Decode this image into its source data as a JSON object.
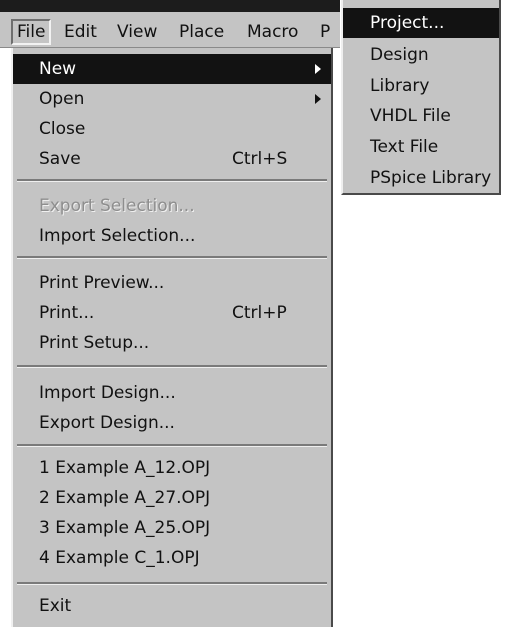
{
  "menubar": {
    "items": [
      "File",
      "Edit",
      "View",
      "Place",
      "Macro",
      "P"
    ]
  },
  "file_menu": {
    "items": [
      {
        "label": "New",
        "submenu_arrow": true,
        "highlighted": true
      },
      {
        "label": "Open",
        "submenu_arrow": true
      },
      {
        "label": "Close"
      },
      {
        "label": "Save",
        "shortcut": "Ctrl+S"
      },
      {
        "label": "Export Selection...",
        "disabled": true
      },
      {
        "label": "Import Selection..."
      },
      {
        "label": "Print Preview..."
      },
      {
        "label": "Print...",
        "shortcut": "Ctrl+P"
      },
      {
        "label": "Print Setup..."
      },
      {
        "label": "Import Design..."
      },
      {
        "label": "Export Design..."
      },
      {
        "label": "1 Example A_12.OPJ"
      },
      {
        "label": "2 Example A_27.OPJ"
      },
      {
        "label": "3 Example A_25.OPJ"
      },
      {
        "label": "4 Example C_1.OPJ"
      },
      {
        "label": "Exit"
      }
    ]
  },
  "new_submenu": {
    "items": [
      {
        "label": "Project...",
        "highlighted": true
      },
      {
        "label": "Design"
      },
      {
        "label": "Library"
      },
      {
        "label": "VHDL File"
      },
      {
        "label": "Text File"
      },
      {
        "label": "PSpice Library"
      }
    ]
  },
  "colors": {
    "menu_background": "#c4c4c4",
    "highlight_background": "#121212",
    "highlight_text": "#ffffff",
    "disabled_text": "#8e8e8e"
  }
}
